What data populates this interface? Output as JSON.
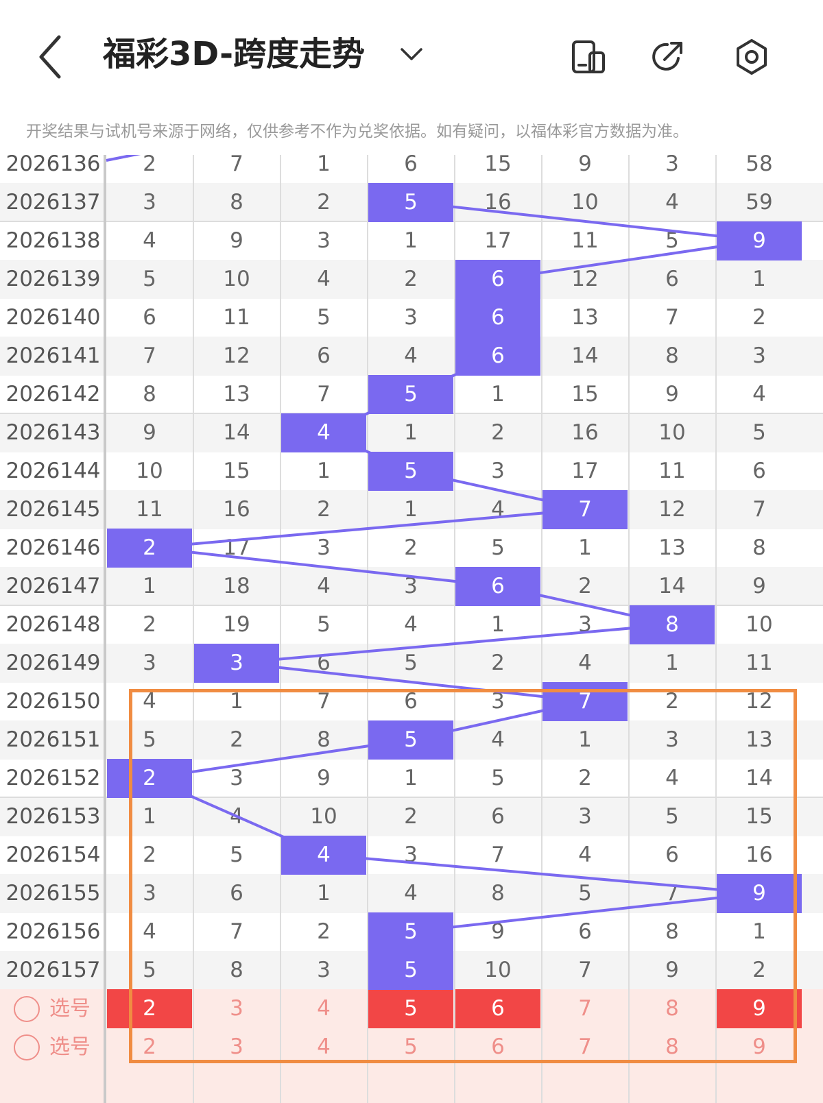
{
  "header": {
    "title": "福彩3D-跨度走势",
    "notice": "开奖结果与试机号来源于网络，仅供参考不作为兑奖依据。如有疑问，以福体彩官方数据为准。"
  },
  "rows": [
    {
      "issue": "2026136",
      "cells": [
        "2",
        "7",
        "1",
        "6",
        "15",
        "9",
        "3",
        "58"
      ],
      "hit": -1
    },
    {
      "issue": "2026137",
      "cells": [
        "3",
        "8",
        "2",
        "5",
        "16",
        "10",
        "4",
        "59"
      ],
      "hit": 3
    },
    {
      "issue": "2026138",
      "cells": [
        "4",
        "9",
        "3",
        "1",
        "17",
        "11",
        "5",
        "9"
      ],
      "hit": 7
    },
    {
      "issue": "2026139",
      "cells": [
        "5",
        "10",
        "4",
        "2",
        "6",
        "12",
        "6",
        "1"
      ],
      "hit": 4
    },
    {
      "issue": "2026140",
      "cells": [
        "6",
        "11",
        "5",
        "3",
        "6",
        "13",
        "7",
        "2"
      ],
      "hit": 4
    },
    {
      "issue": "2026141",
      "cells": [
        "7",
        "12",
        "6",
        "4",
        "6",
        "14",
        "8",
        "3"
      ],
      "hit": 4
    },
    {
      "issue": "2026142",
      "cells": [
        "8",
        "13",
        "7",
        "5",
        "1",
        "15",
        "9",
        "4"
      ],
      "hit": 3
    },
    {
      "issue": "2026143",
      "cells": [
        "9",
        "14",
        "4",
        "1",
        "2",
        "16",
        "10",
        "5"
      ],
      "hit": 2
    },
    {
      "issue": "2026144",
      "cells": [
        "10",
        "15",
        "1",
        "5",
        "3",
        "17",
        "11",
        "6"
      ],
      "hit": 3
    },
    {
      "issue": "2026145",
      "cells": [
        "11",
        "16",
        "2",
        "1",
        "4",
        "7",
        "12",
        "7"
      ],
      "hit": 5
    },
    {
      "issue": "2026146",
      "cells": [
        "2",
        "17",
        "3",
        "2",
        "5",
        "1",
        "13",
        "8"
      ],
      "hit": 0
    },
    {
      "issue": "2026147",
      "cells": [
        "1",
        "18",
        "4",
        "3",
        "6",
        "2",
        "14",
        "9"
      ],
      "hit": 4
    },
    {
      "issue": "2026148",
      "cells": [
        "2",
        "19",
        "5",
        "4",
        "1",
        "3",
        "8",
        "10"
      ],
      "hit": 6
    },
    {
      "issue": "2026149",
      "cells": [
        "3",
        "3",
        "6",
        "5",
        "2",
        "4",
        "1",
        "11"
      ],
      "hit": 1
    },
    {
      "issue": "2026150",
      "cells": [
        "4",
        "1",
        "7",
        "6",
        "3",
        "7",
        "2",
        "12"
      ],
      "hit": 5
    },
    {
      "issue": "2026151",
      "cells": [
        "5",
        "2",
        "8",
        "5",
        "4",
        "1",
        "3",
        "13"
      ],
      "hit": 3
    },
    {
      "issue": "2026152",
      "cells": [
        "2",
        "3",
        "9",
        "1",
        "5",
        "2",
        "4",
        "14"
      ],
      "hit": 0
    },
    {
      "issue": "2026153",
      "cells": [
        "1",
        "4",
        "10",
        "2",
        "6",
        "3",
        "5",
        "15"
      ],
      "hit": -1
    },
    {
      "issue": "2026154",
      "cells": [
        "2",
        "5",
        "4",
        "3",
        "7",
        "4",
        "6",
        "16"
      ],
      "hit": 2
    },
    {
      "issue": "2026155",
      "cells": [
        "3",
        "6",
        "1",
        "4",
        "8",
        "5",
        "7",
        "9"
      ],
      "hit": 7
    },
    {
      "issue": "2026156",
      "cells": [
        "4",
        "7",
        "2",
        "5",
        "9",
        "6",
        "8",
        "1"
      ],
      "hit": 3
    },
    {
      "issue": "2026157",
      "cells": [
        "5",
        "8",
        "3",
        "5",
        "10",
        "7",
        "9",
        "2"
      ],
      "hit": 3
    }
  ],
  "select_rows": [
    {
      "label": "选号",
      "cells": [
        "2",
        "3",
        "4",
        "5",
        "6",
        "7",
        "8",
        "9"
      ],
      "picked": [
        0,
        3,
        4,
        7
      ]
    },
    {
      "label": "选号",
      "cells": [
        "2",
        "3",
        "4",
        "5",
        "6",
        "7",
        "8",
        "9"
      ],
      "picked": []
    }
  ],
  "colors": {
    "hit": "#7a69f0",
    "line": "#7a69f0",
    "pick": "#f24646",
    "frame": "#f08c42"
  }
}
